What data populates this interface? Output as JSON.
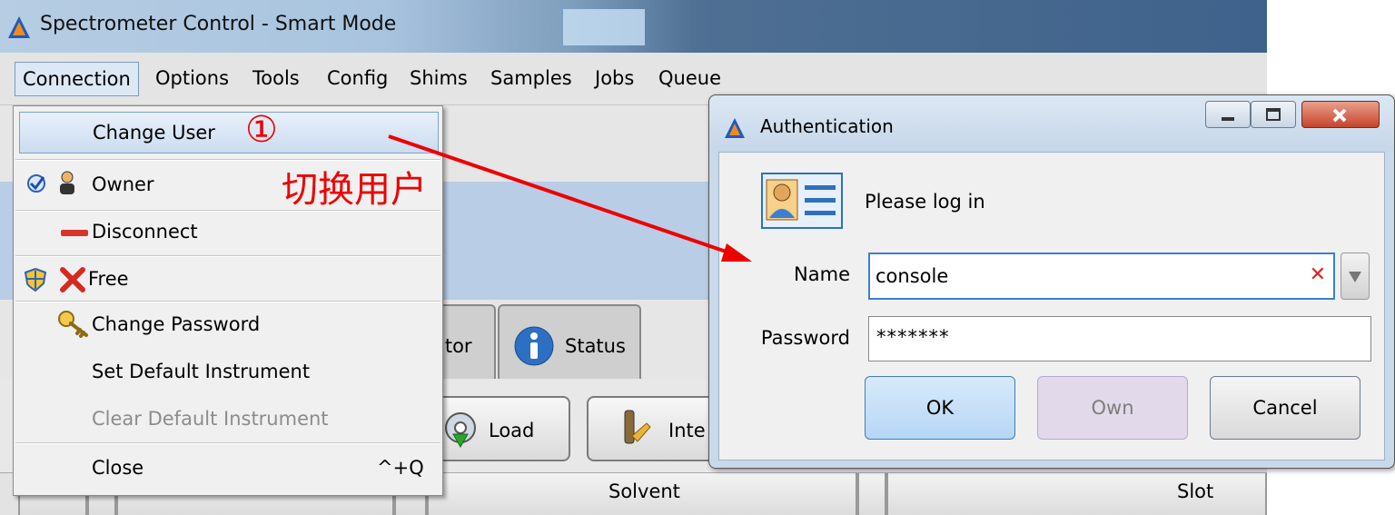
{
  "window": {
    "title": "Spectrometer Control - Smart Mode"
  },
  "menubar": {
    "items": [
      "Connection",
      "Options",
      "Tools",
      "Config",
      "Shims",
      "Samples",
      "Jobs",
      "Queue"
    ]
  },
  "connection_menu": {
    "items": [
      {
        "label": "Change User",
        "icon": "none",
        "highlighted": true
      },
      {
        "label": "Owner",
        "icon": "owner-check-icon"
      },
      {
        "label": "Disconnect",
        "icon": "disconnect-icon"
      },
      {
        "label": "Free",
        "icon": "shield-x-icon"
      },
      {
        "label": "Change Password",
        "icon": "key-icon"
      },
      {
        "label": "Set Default Instrument",
        "icon": "none"
      },
      {
        "label": "Clear Default Instrument",
        "icon": "none",
        "disabled": true
      },
      {
        "label": "Close",
        "shortcut": "^+Q"
      }
    ]
  },
  "annotations": {
    "step": "①",
    "note": "切换用户",
    "color": "#e00000"
  },
  "tabs": {
    "monitor_partial": "itor",
    "status": "Status"
  },
  "action_buttons": {
    "load": "Load",
    "int_partial": "Inte"
  },
  "table": {
    "columns": [
      "Solvent",
      "Slot"
    ]
  },
  "auth_dialog": {
    "title": "Authentication",
    "prompt": "Please log in",
    "name_label": "Name",
    "name_value": "console",
    "password_label": "Password",
    "password_value": "*******",
    "ok": "OK",
    "own": "Own",
    "cancel": "Cancel"
  }
}
